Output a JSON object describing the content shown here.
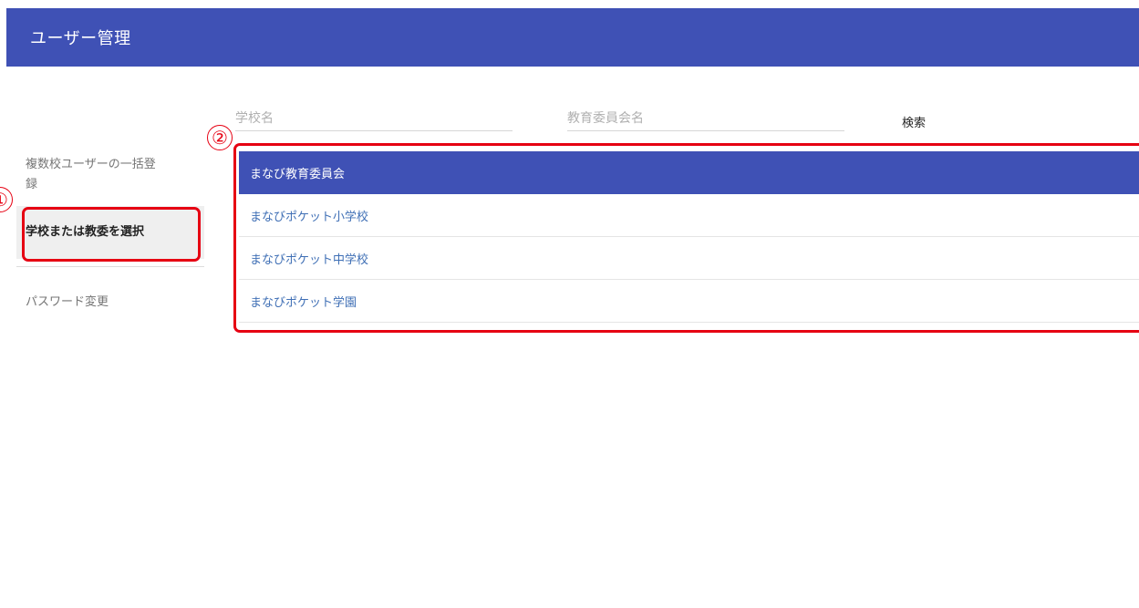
{
  "header": {
    "title": "ユーザー管理"
  },
  "sidebar": {
    "items": [
      {
        "label": "複数校ユーザーの一括登録"
      },
      {
        "label": "学校または教委を選択"
      },
      {
        "label": "パスワード変更"
      }
    ]
  },
  "search": {
    "school_placeholder": "学校名",
    "board_placeholder": "教育委員会名",
    "search_label": "検索"
  },
  "results": {
    "items": [
      {
        "label": "まなび教育委員会"
      },
      {
        "label": "まなびポケット小学校"
      },
      {
        "label": "まなびポケット中学校"
      },
      {
        "label": "まなびポケット学園"
      }
    ]
  },
  "annotations": {
    "marker_1": "①",
    "marker_2": "②"
  },
  "colors": {
    "header_bg": "#3f51b5",
    "annotation": "#e60012",
    "link": "#3f6fb5"
  }
}
